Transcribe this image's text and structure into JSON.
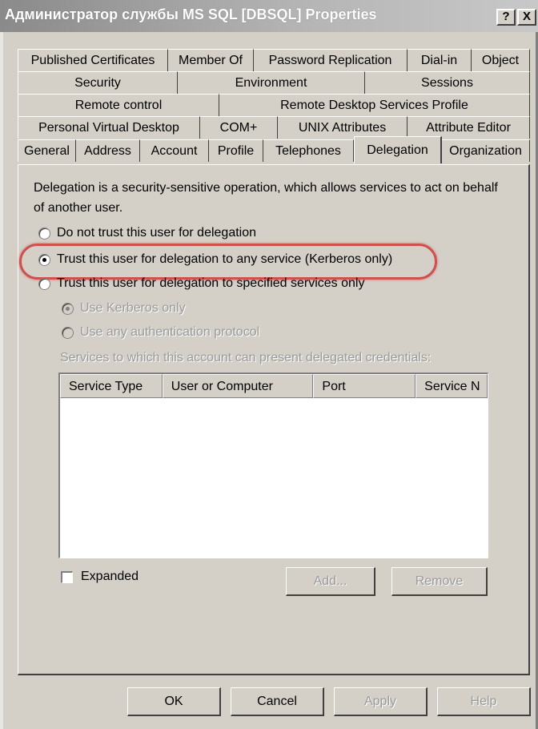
{
  "window": {
    "title": "Администратор службы MS SQL [DBSQL] Properties",
    "help_glyph": "?",
    "close_glyph": "X"
  },
  "tabs": {
    "row1": [
      "Published Certificates",
      "Member Of",
      "Password Replication",
      "Dial-in",
      "Object"
    ],
    "row2": [
      "Security",
      "Environment",
      "Sessions"
    ],
    "row3": [
      "Remote control",
      "Remote Desktop Services Profile"
    ],
    "row4": [
      "Personal Virtual Desktop",
      "COM+",
      "UNIX Attributes",
      "Attribute Editor"
    ],
    "row5": [
      "General",
      "Address",
      "Account",
      "Profile",
      "Telephones",
      "Delegation",
      "Organization"
    ],
    "active": "Delegation"
  },
  "delegation": {
    "description": "Delegation is a security-sensitive operation, which allows services to act on behalf of another user.",
    "options": [
      {
        "label": "Do not trust this user for delegation",
        "checked": false
      },
      {
        "label": "Trust this user for delegation to any service (Kerberos only)",
        "checked": true
      },
      {
        "label": "Trust this user for delegation to specified services only",
        "checked": false
      }
    ],
    "sub_options": [
      {
        "label": "Use Kerberos only",
        "checked": true,
        "disabled": true
      },
      {
        "label": "Use any authentication protocol",
        "checked": false,
        "disabled": true
      }
    ],
    "services_label": "Services to which this account can present delegated credentials:",
    "columns": [
      "Service Type",
      "User or Computer",
      "Port",
      "Service N"
    ],
    "rows": [],
    "expanded_label": "Expanded",
    "expanded_checked": false,
    "add_label": "Add...",
    "remove_label": "Remove"
  },
  "buttons": {
    "ok": "OK",
    "cancel": "Cancel",
    "apply": "Apply",
    "help": "Help"
  },
  "colors": {
    "dialog_face": "#d4d0c8",
    "highlight_ring": "#d0504e"
  }
}
